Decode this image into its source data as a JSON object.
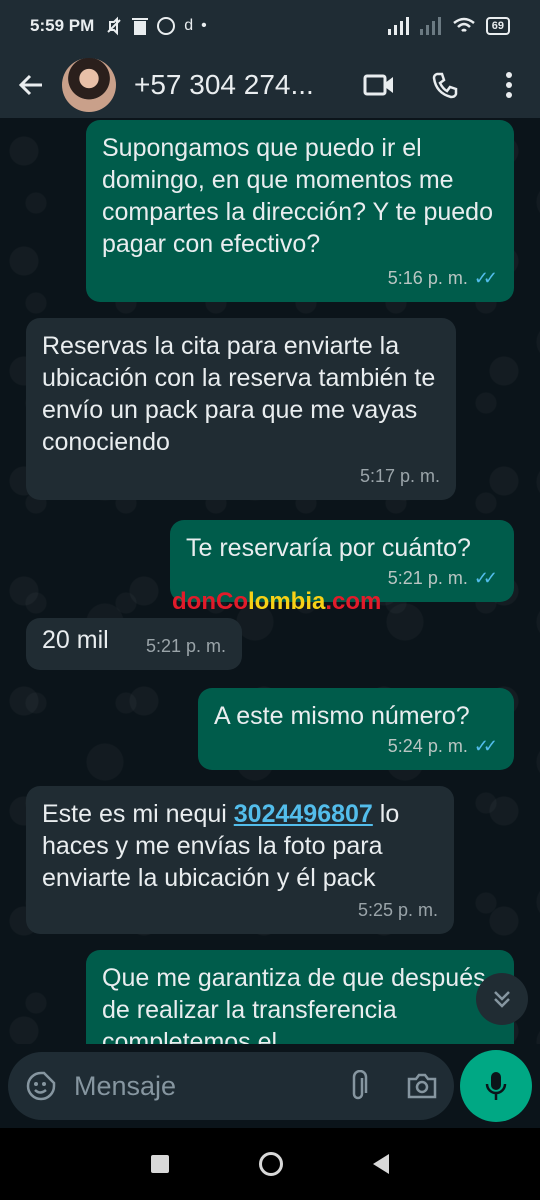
{
  "status_bar": {
    "time": "5:59 PM",
    "notification_icons": [
      "mute-icon",
      "trash-icon",
      "whatsapp-icon",
      "app-d-icon",
      "dot-icon"
    ],
    "battery": "69"
  },
  "header": {
    "contact_name": "+57 304 274...",
    "icons": [
      "back-arrow-icon",
      "video-call-icon",
      "phone-icon",
      "more-vert-icon"
    ]
  },
  "messages": [
    {
      "direction": "out",
      "text": "Supongamos que puedo ir el domingo, en que momentos me compartes la dirección? Y te puedo pagar con efectivo?",
      "time": "5:16 p. m.",
      "read": true
    },
    {
      "direction": "in",
      "text": "Reservas la cita para enviarte la ubicación con la reserva también te envío un pack para que me vayas conociendo",
      "time": "5:17 p. m."
    },
    {
      "direction": "out",
      "text": "Te reservaría por cuánto?",
      "time": "5:21 p. m.",
      "read": true
    },
    {
      "direction": "in",
      "text": "20 mil",
      "time": "5:21 p. m."
    },
    {
      "direction": "out",
      "text": "A este mismo número?",
      "time": "5:24 p. m.",
      "read": true
    },
    {
      "direction": "in",
      "text_before": "Este es mi nequi ",
      "link": "3024496807",
      "text_after": " lo haces y me envías la foto para enviarte la ubicación y él pack",
      "time": "5:25 p. m."
    },
    {
      "direction": "out",
      "text": "Que me garantiza de que después de realizar la transferencia completemos el"
    }
  ],
  "watermark": {
    "part1": "donCo",
    "part2": "lombia",
    "part3": ".com"
  },
  "composer": {
    "placeholder": "Mensaje"
  },
  "colors": {
    "outgoing_bubble": "#005c4b",
    "incoming_bubble": "#202c33",
    "accent": "#00a884",
    "link": "#53bdeb"
  }
}
